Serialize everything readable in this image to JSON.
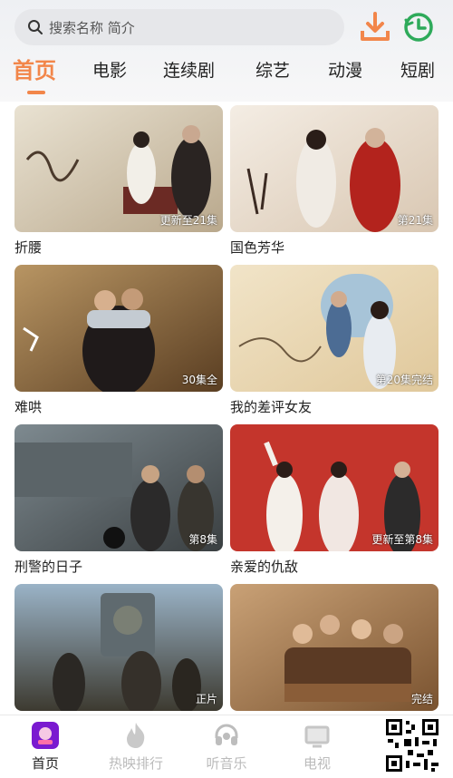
{
  "search": {
    "placeholder": "搜索名称 简介"
  },
  "tabs": [
    {
      "label": "首页",
      "active": true
    },
    {
      "label": "电影"
    },
    {
      "label": "连续剧"
    },
    {
      "label": "综艺"
    },
    {
      "label": "动漫"
    },
    {
      "label": "短剧"
    }
  ],
  "colors": {
    "accent": "#f2864a",
    "history_green": "#2eaa5a",
    "app_icon": "#7a1ad0"
  },
  "cards": [
    {
      "title": "折腰",
      "badge": "更新至21集"
    },
    {
      "title": "国色芳华",
      "badge": "第21集"
    },
    {
      "title": "难哄",
      "badge": "30集全"
    },
    {
      "title": "我的差评女友",
      "badge": "第20集完结"
    },
    {
      "title": "刑警的日子",
      "badge": "第8集"
    },
    {
      "title": "亲爱的仇敌",
      "badge": "更新至第8集"
    },
    {
      "title": "",
      "badge": "正片"
    },
    {
      "title": "",
      "badge": "完结"
    }
  ],
  "bottom_nav": [
    {
      "label": "首页",
      "icon": "home-app-icon",
      "active": true
    },
    {
      "label": "热映排行",
      "icon": "flame-icon"
    },
    {
      "label": "听音乐",
      "icon": "headphones-icon"
    },
    {
      "label": "电视",
      "icon": "tv-icon"
    }
  ]
}
